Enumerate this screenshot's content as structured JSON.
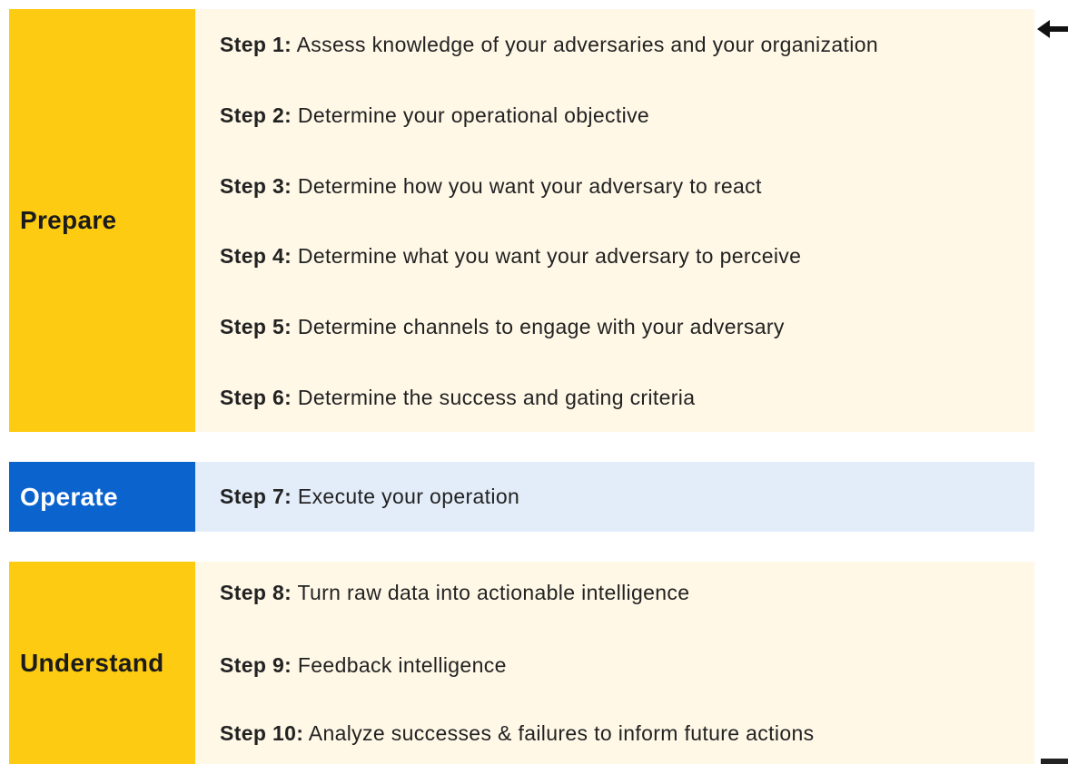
{
  "phases": [
    {
      "label": "Prepare",
      "color": "#FDCB12",
      "background": "#FFF8E7",
      "steps": [
        {
          "num": "Step 1:",
          "text": " Assess knowledge of your adversaries and your organization"
        },
        {
          "num": "Step 2:",
          "text": " Determine your operational objective"
        },
        {
          "num": "Step 3:",
          "text": " Determine how you want your adversary to react"
        },
        {
          "num": "Step 4:",
          "text": " Determine what you want your adversary to perceive"
        },
        {
          "num": "Step 5:",
          "text": " Determine channels to engage with your adversary"
        },
        {
          "num": "Step 6:",
          "text": " Determine the success and gating criteria"
        }
      ]
    },
    {
      "label": "Operate",
      "color": "#0B63CE",
      "background": "#E3EDF9",
      "steps": [
        {
          "num": "Step 7:",
          "text": " Execute your operation"
        }
      ]
    },
    {
      "label": "Understand",
      "color": "#FDCB12",
      "background": "#FFF8E7",
      "steps": [
        {
          "num": "Step 8:",
          "text": " Turn raw data into actionable intelligence"
        },
        {
          "num": "Step 9:",
          "text": " Feedback intelligence"
        },
        {
          "num": "Step 10:",
          "text": " Analyze successes & failures to inform future actions"
        }
      ]
    }
  ],
  "icons": {
    "arrow": "arrow-left-icon"
  }
}
